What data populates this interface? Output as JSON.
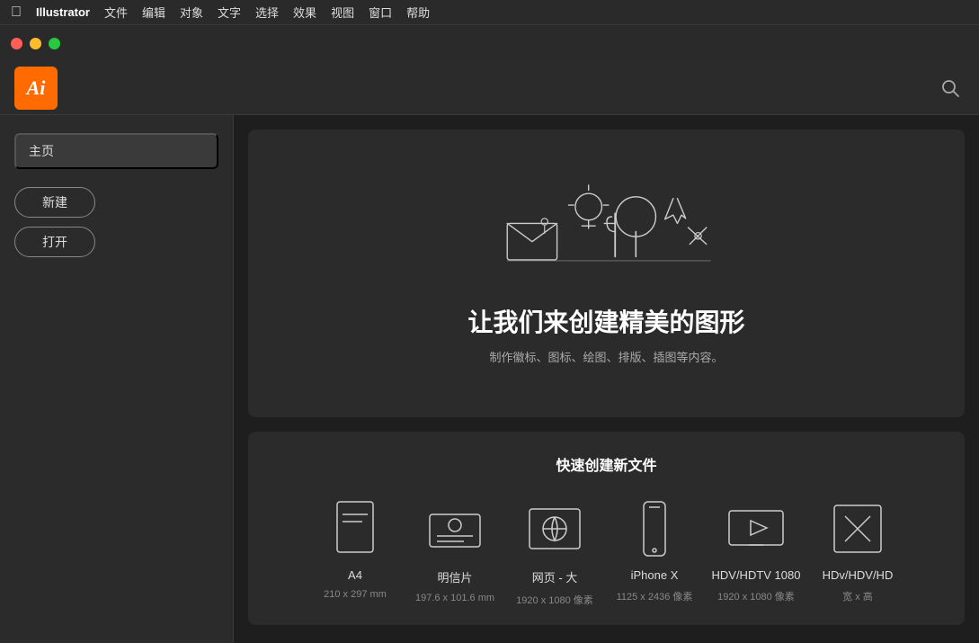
{
  "menubar": {
    "apple": "⌘",
    "app_name": "Illustrator",
    "items": [
      "文件",
      "编辑",
      "对象",
      "文字",
      "选择",
      "效果",
      "视图",
      "窗口",
      "帮助"
    ]
  },
  "toolbar": {
    "logo_text": "Ai",
    "search_label": "搜索"
  },
  "sidebar": {
    "home_label": "主页",
    "new_button": "新建",
    "open_button": "打开"
  },
  "hero": {
    "title": "让我们来创建精美的图形",
    "subtitle": "制作徽标、图标、绘图、排版、插图等内容。"
  },
  "quick_create": {
    "title": "快速创建新文件",
    "templates": [
      {
        "name": "A4",
        "size": "210 x 297 mm",
        "type": "a4"
      },
      {
        "name": "明信片",
        "size": "197.6 x 101.6 mm",
        "type": "postcard"
      },
      {
        "name": "网页 - 大",
        "size": "1920 x 1080 像素",
        "type": "web"
      },
      {
        "name": "iPhone X",
        "size": "1125 x 2436 像素",
        "type": "iphone"
      },
      {
        "name": "HDV/HDTV 1080",
        "size": "1920 x 1080 像素",
        "type": "hdtv"
      },
      {
        "name": "HDv/HDV/HD",
        "size": "宽 x 高",
        "type": "custom"
      }
    ]
  }
}
